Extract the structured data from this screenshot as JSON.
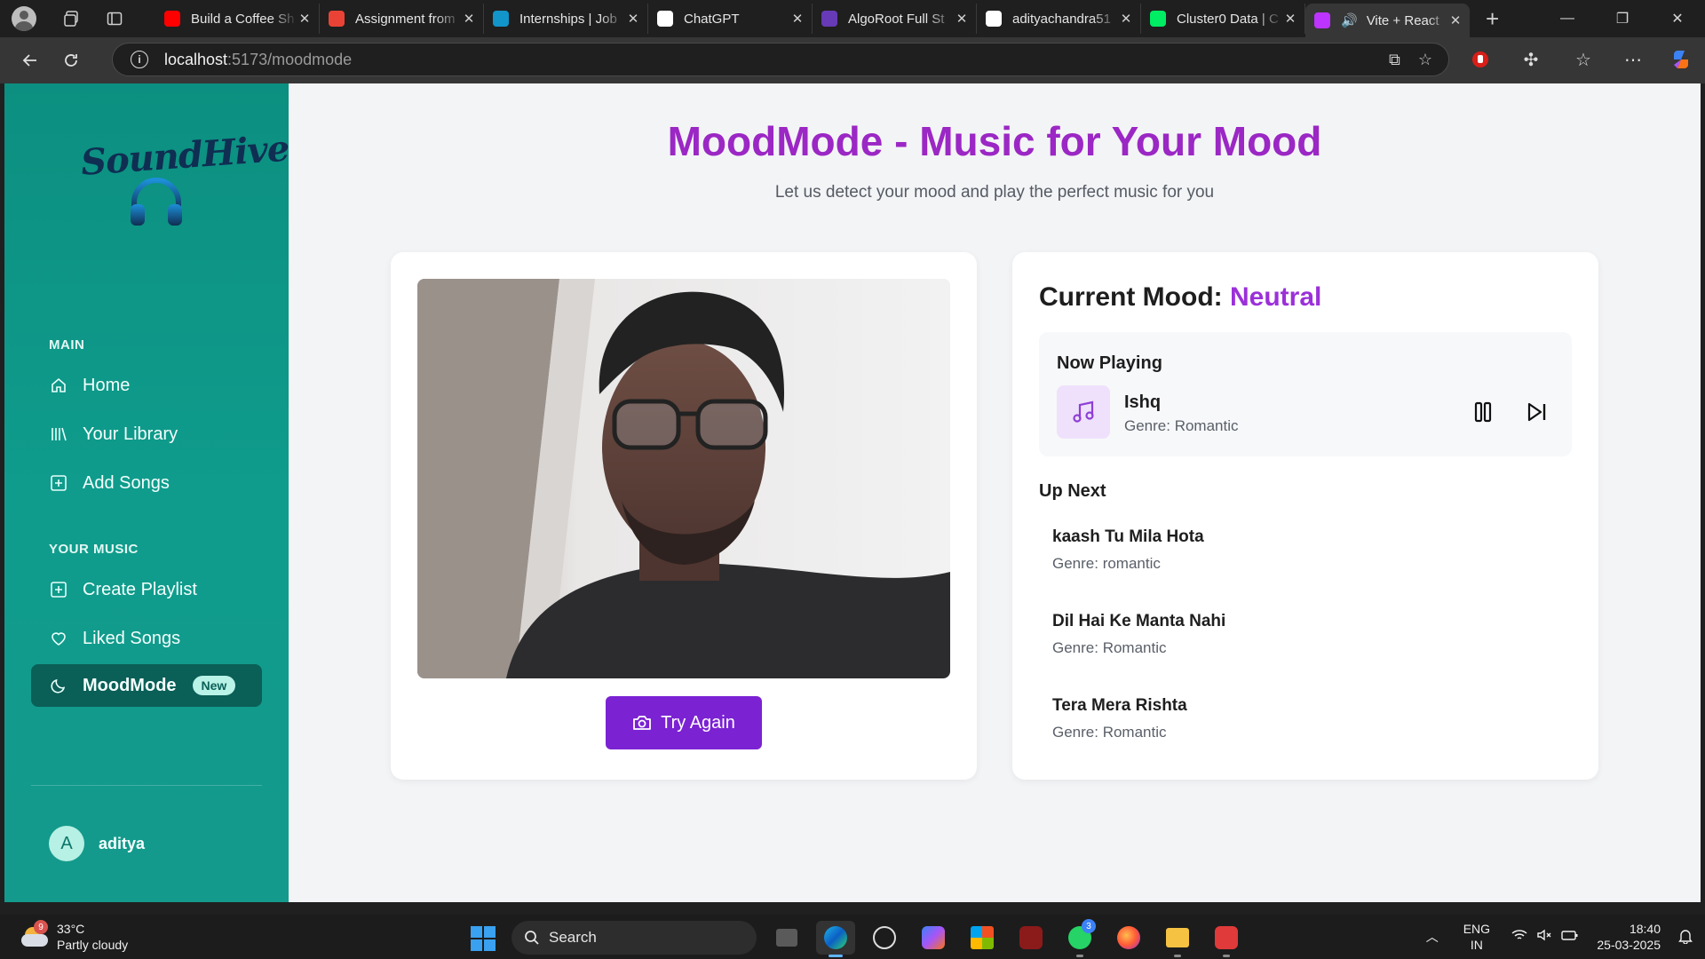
{
  "browser": {
    "tabs": [
      {
        "title": "Build a Coffee Sh",
        "favicon": "youtube-icon",
        "color": "#ff0000"
      },
      {
        "title": "Assignment from",
        "favicon": "gmail-icon",
        "color": "#ea4335"
      },
      {
        "title": "Internships | Job",
        "favicon": "internshala-icon",
        "color": "#1295c9"
      },
      {
        "title": "ChatGPT",
        "favicon": "chatgpt-icon",
        "color": "#ffffff"
      },
      {
        "title": "AlgoRoot Full St",
        "favicon": "form-icon",
        "color": "#673ab7"
      },
      {
        "title": "adityachandra51",
        "favicon": "github-icon",
        "color": "#ffffff"
      },
      {
        "title": "Cluster0 Data | C",
        "favicon": "mongodb-icon",
        "color": "#00ed64"
      },
      {
        "title": "Vite + React",
        "favicon": "vite-icon",
        "color": "#bd34fe",
        "active": true
      }
    ],
    "url_host": "localhost",
    "url_path": ":5173/moodmode"
  },
  "sidebar": {
    "logo_text": "SoundHive",
    "main_label": "MAIN",
    "main_items": [
      {
        "label": "Home",
        "icon": "home-icon"
      },
      {
        "label": "Your Library",
        "icon": "library-icon"
      },
      {
        "label": "Add Songs",
        "icon": "plus-square-icon"
      }
    ],
    "music_label": "YOUR MUSIC",
    "music_items": [
      {
        "label": "Create Playlist",
        "icon": "plus-square-icon"
      },
      {
        "label": "Liked Songs",
        "icon": "heart-icon"
      },
      {
        "label": "MoodMode",
        "icon": "moon-icon",
        "badge": "New",
        "active": true
      }
    ],
    "user_initial": "A",
    "user_name": "aditya"
  },
  "main": {
    "title": "MoodMode - Music for Your Mood",
    "subtitle": "Let us detect your mood and play the perfect music for you",
    "try_again_label": "Try Again",
    "mood_label": "Current Mood:",
    "mood_value": "Neutral",
    "now_playing_label": "Now Playing",
    "now_playing": {
      "title": "Ishq",
      "genre": "Genre: Romantic"
    },
    "up_next_label": "Up Next",
    "queue": [
      {
        "title": "kaash Tu Mila Hota",
        "genre": "Genre: romantic"
      },
      {
        "title": "Dil Hai Ke Manta Nahi",
        "genre": "Genre: Romantic"
      },
      {
        "title": "Tera Mera Rishta",
        "genre": "Genre: Romantic"
      }
    ],
    "accent_color": "#9b27c4",
    "button_color": "#7b22d3"
  },
  "taskbar": {
    "weather_temp": "33°C",
    "weather_desc": "Partly cloudy",
    "weather_badge": "9",
    "search_placeholder": "Search",
    "whatsapp_badge": "3",
    "lang_top": "ENG",
    "lang_bottom": "IN",
    "time": "18:40",
    "date": "25-03-2025"
  }
}
